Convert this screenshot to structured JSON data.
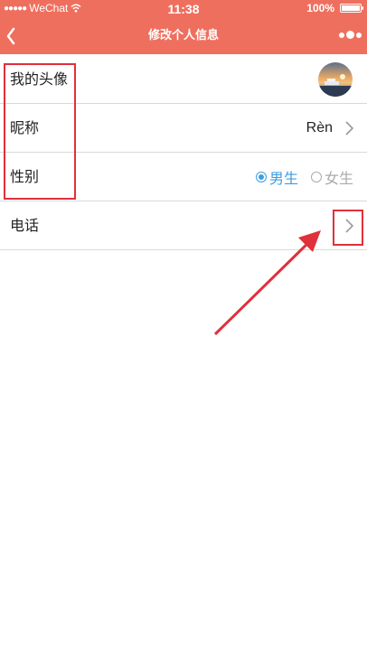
{
  "status_bar": {
    "carrier": "WeChat",
    "time": "11:38",
    "battery": "100%",
    "battery_level": 1.0
  },
  "nav": {
    "title": "修改个人信息"
  },
  "rows": {
    "avatar": {
      "label": "我的头像"
    },
    "nickname": {
      "label": "昵称",
      "value": "Rèn"
    },
    "gender": {
      "label": "性别",
      "options": [
        {
          "label": "男生",
          "selected": true
        },
        {
          "label": "女生",
          "selected": false
        }
      ]
    },
    "phone": {
      "label": "电话"
    }
  },
  "colors": {
    "header": "#ef6f5e",
    "accent": "#3d9de0",
    "annotation": "#e0303a"
  },
  "icons": [
    "wifi-icon",
    "battery-icon",
    "back-icon",
    "more-icon",
    "chevron-right-icon",
    "radio-icon"
  ]
}
